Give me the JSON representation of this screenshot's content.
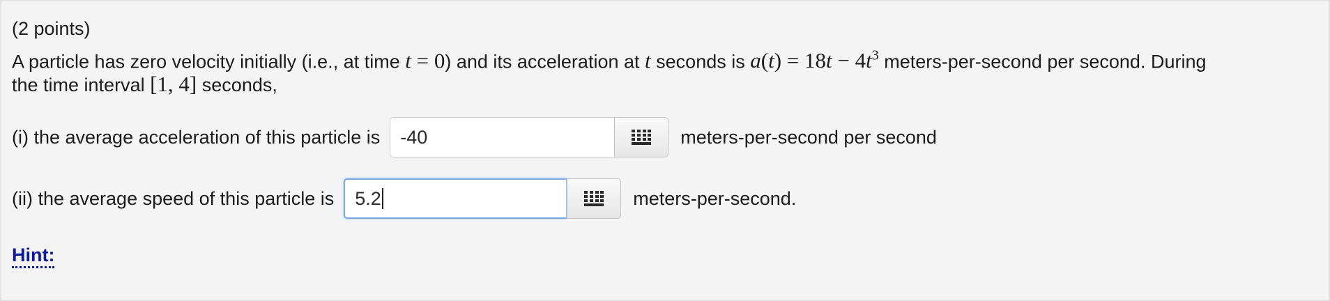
{
  "problem": {
    "points": "(2 points)",
    "statement": {
      "p1": "A particle has zero velocity initially (i.e., at time",
      "m1": "t = 0",
      "p2": ") and its acceleration at",
      "m2": "t",
      "p3": "seconds is",
      "m3": "a(t) = 18t − 4t³",
      "p4": "meters-per-second per second. During",
      "p5": "the time interval",
      "m4": "[1, 4]",
      "p6": "seconds,"
    },
    "part1": {
      "label": "(i) the average acceleration of this particle is",
      "value": "-40",
      "units": "meters-per-second per second"
    },
    "part2": {
      "label": "(ii) the average speed of this particle is",
      "value": "5.2",
      "units": "meters-per-second."
    },
    "hint_label": "Hint:",
    "icons": {
      "palette": "equation-palette-icon"
    },
    "colors": {
      "hint": "#0c1a9c",
      "focus_border": "#76a9e6",
      "background": "#f4f4f4"
    }
  }
}
